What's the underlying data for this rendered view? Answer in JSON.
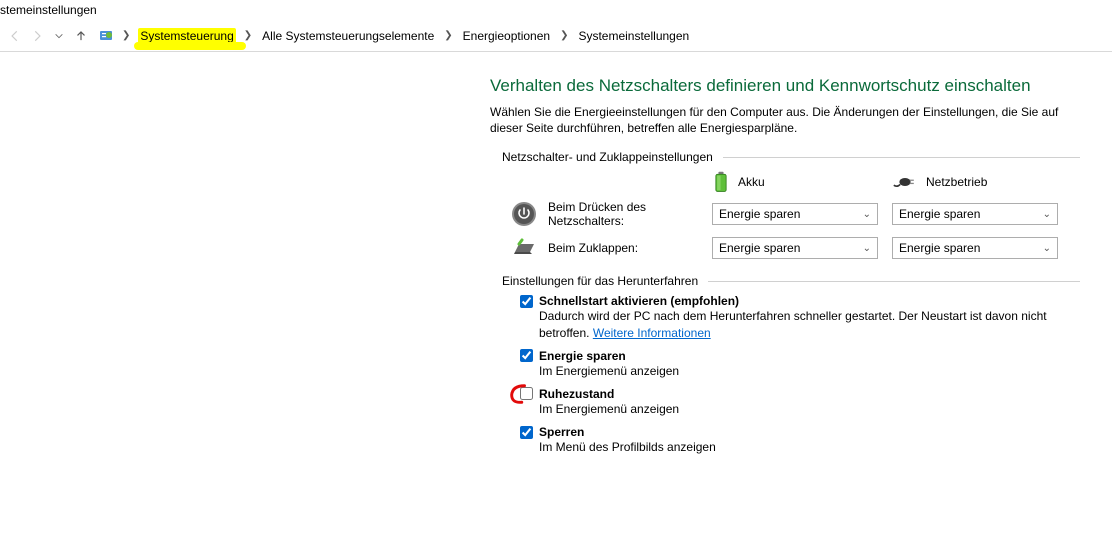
{
  "window_title": "stemeinstellungen",
  "breadcrumb": {
    "items": [
      "Systemsteuerung",
      "Alle Systemsteuerungselemente",
      "Energieoptionen",
      "Systemeinstellungen"
    ]
  },
  "page": {
    "heading": "Verhalten des Netzschalters definieren und Kennwortschutz einschalten",
    "intro": "Wählen Sie die Energieeinstellungen für den Computer aus. Die Änderungen der Einstellungen, die Sie auf dieser Seite durchführen, betreffen alle Energiesparpläne.",
    "section1_title": "Netzschalter- und Zuklappeinstellungen",
    "col_battery": "Akku",
    "col_ac": "Netzbetrieb",
    "row_power_label": "Beim Drücken des Netzschalters:",
    "row_lid_label": "Beim Zuklappen:",
    "dropdowns": {
      "power_battery": "Energie sparen",
      "power_ac": "Energie sparen",
      "lid_battery": "Energie sparen",
      "lid_ac": "Energie sparen"
    },
    "section2_title": "Einstellungen für das Herunterfahren",
    "options": {
      "fastboot": {
        "label": "Schnellstart aktivieren (empfohlen)",
        "checked": true,
        "desc_pre": "Dadurch wird der PC nach dem Herunterfahren schneller gestartet. Der Neustart ist davon nicht betroffen. ",
        "link": "Weitere Informationen"
      },
      "sleep": {
        "label": "Energie sparen",
        "checked": true,
        "desc": "Im Energiemenü anzeigen"
      },
      "hibernate": {
        "label": "Ruhezustand",
        "checked": false,
        "desc": "Im Energiemenü anzeigen"
      },
      "lock": {
        "label": "Sperren",
        "checked": true,
        "desc": "Im Menü des Profilbilds anzeigen"
      }
    }
  }
}
